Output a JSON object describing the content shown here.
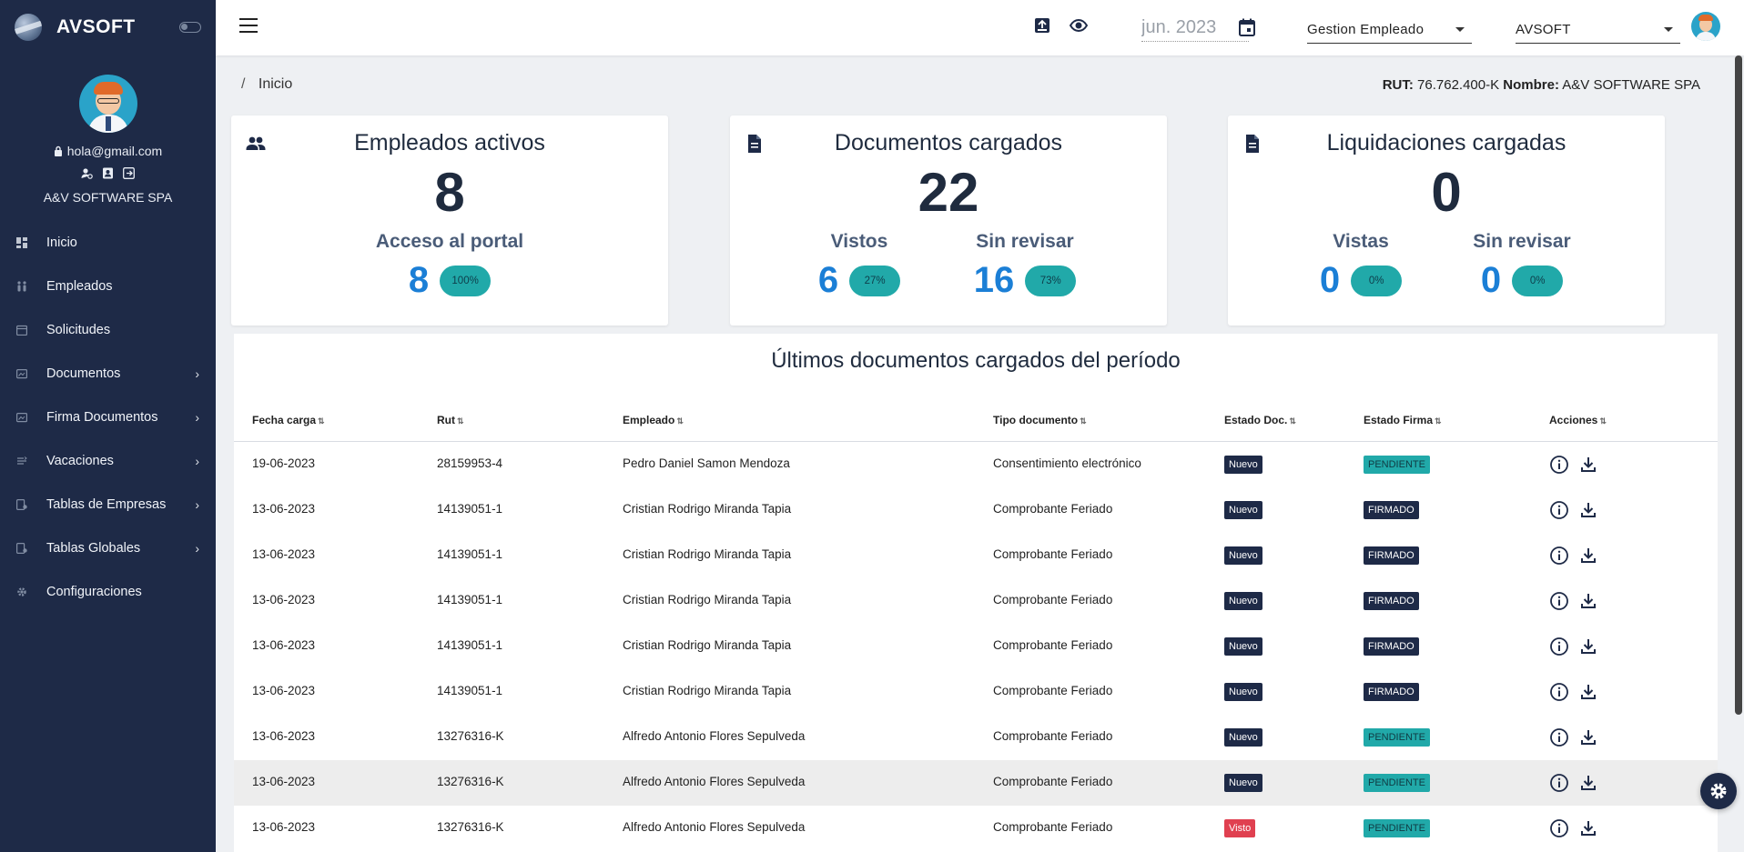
{
  "brand": {
    "name": "AVSOFT"
  },
  "profile": {
    "email": "hola@gmail.com",
    "company": "A&V SOFTWARE SPA"
  },
  "sidebar": {
    "items": [
      {
        "label": "Inicio",
        "icon": "dashboard-icon",
        "has_children": false
      },
      {
        "label": "Empleados",
        "icon": "people-icon",
        "has_children": false
      },
      {
        "label": "Solicitudes",
        "icon": "calendar-icon",
        "has_children": false
      },
      {
        "label": "Documentos",
        "icon": "documents-icon",
        "has_children": true
      },
      {
        "label": "Firma Documentos",
        "icon": "signature-icon",
        "has_children": true
      },
      {
        "label": "Vacaciones",
        "icon": "vacation-icon",
        "has_children": true
      },
      {
        "label": "Tablas de Empresas",
        "icon": "company-table-icon",
        "has_children": true
      },
      {
        "label": "Tablas Globales",
        "icon": "global-table-icon",
        "has_children": true
      },
      {
        "label": "Configuraciones",
        "icon": "gear-icon",
        "has_children": false
      }
    ]
  },
  "topbar": {
    "period_value": "jun. 2023",
    "role_select": "Gestion Empleado",
    "company_select": "AVSOFT"
  },
  "breadcrumb": {
    "separator": "/",
    "current": "Inicio"
  },
  "company_info": {
    "rut_label": "RUT:",
    "rut_value": "76.762.400-K",
    "name_label": "Nombre:",
    "name_value": "A&V SOFTWARE SPA"
  },
  "cards": {
    "empleados": {
      "title": "Empleados activos",
      "total": "8",
      "sub1_title": "Acceso al portal",
      "sub1_value": "8",
      "sub1_pct": "100%"
    },
    "documentos": {
      "title": "Documentos cargados",
      "total": "22",
      "sub1_title": "Vistos",
      "sub1_value": "6",
      "sub1_pct": "27%",
      "sub2_title": "Sin revisar",
      "sub2_value": "16",
      "sub2_pct": "73%"
    },
    "liquidaciones": {
      "title": "Liquidaciones cargadas",
      "total": "0",
      "sub1_title": "Vistas",
      "sub1_value": "0",
      "sub1_pct": "0%",
      "sub2_title": "Sin revisar",
      "sub2_value": "0",
      "sub2_pct": "0%"
    }
  },
  "table": {
    "title": "Últimos documentos cargados del período",
    "columns": [
      "Fecha carga",
      "Rut",
      "Empleado",
      "Tipo documento",
      "Estado Doc.",
      "Estado Firma",
      "Acciones"
    ],
    "rows": [
      [
        "19-06-2023",
        "28159953-4",
        "Pedro Daniel Samon Mendoza",
        "Consentimiento electrónico",
        "Nuevo",
        "PENDIENTE"
      ],
      [
        "13-06-2023",
        "14139051-1",
        "Cristian Rodrigo Miranda Tapia",
        "Comprobante Feriado",
        "Nuevo",
        "FIRMADO"
      ],
      [
        "13-06-2023",
        "14139051-1",
        "Cristian Rodrigo Miranda Tapia",
        "Comprobante Feriado",
        "Nuevo",
        "FIRMADO"
      ],
      [
        "13-06-2023",
        "14139051-1",
        "Cristian Rodrigo Miranda Tapia",
        "Comprobante Feriado",
        "Nuevo",
        "FIRMADO"
      ],
      [
        "13-06-2023",
        "14139051-1",
        "Cristian Rodrigo Miranda Tapia",
        "Comprobante Feriado",
        "Nuevo",
        "FIRMADO"
      ],
      [
        "13-06-2023",
        "14139051-1",
        "Cristian Rodrigo Miranda Tapia",
        "Comprobante Feriado",
        "Nuevo",
        "FIRMADO"
      ],
      [
        "13-06-2023",
        "13276316-K",
        "Alfredo Antonio Flores Sepulveda",
        "Comprobante Feriado",
        "Nuevo",
        "PENDIENTE"
      ],
      [
        "13-06-2023",
        "13276316-K",
        "Alfredo Antonio Flores Sepulveda",
        "Comprobante Feriado",
        "Nuevo",
        "PENDIENTE"
      ],
      [
        "13-06-2023",
        "13276316-K",
        "Alfredo Antonio Flores Sepulveda",
        "Comprobante Feriado",
        "Visto",
        "PENDIENTE"
      ]
    ]
  },
  "colors": {
    "sidebar_bg": "#1e2a47",
    "accent_teal": "#21a9a9",
    "accent_blue": "#1b7fd6",
    "badge_red": "#e04050"
  }
}
